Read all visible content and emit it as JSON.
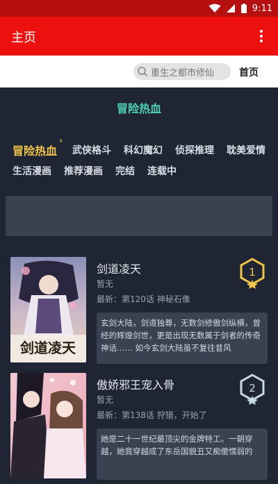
{
  "status_bar": {
    "time": "9:11",
    "icons": [
      "wifi-icon",
      "signal-icon",
      "battery-icon"
    ]
  },
  "app_bar": {
    "title": "主页",
    "menu_icon": "more-vertical-icon"
  },
  "search": {
    "placeholder": "重生之都市修仙",
    "home_label": "首页"
  },
  "section": {
    "title": "冒险热血"
  },
  "categories": [
    "冒险热血",
    "武侠格斗",
    "科幻魔幻",
    "侦探推理",
    "耽美爱情",
    "生活漫画",
    "推荐漫画",
    "完结",
    "连载中"
  ],
  "active_category": "冒险热血",
  "comics": [
    {
      "title": "剑道凌天",
      "subtitle": "暂无",
      "latest": "最新：第120话 神秘石像",
      "description": "玄剑大陆，剑道独尊，无数剑修傲剑纵横，曾经的辉煌剑世，更是出现无数属于剑者的传奇神话…… 如今玄剑大陆虽不复往昔风",
      "rank": "1",
      "cover_text": "剑道凌天"
    },
    {
      "title": "傲娇邪王宠入骨",
      "subtitle": "暂无",
      "latest": "最新：第138话 狩猎，开始了",
      "description": "她是二十一世纪最顶尖的金牌特工。一朝穿越，她竟穿越成了东岳国貌丑又痴傻懦弱的",
      "rank": "2"
    }
  ],
  "colors": {
    "status_bar": "#b50f0f",
    "app_bar": "#ee0f0f",
    "background": "#1f2533",
    "accent": "#4fd3b5",
    "active_tab": "#f0c54a"
  }
}
